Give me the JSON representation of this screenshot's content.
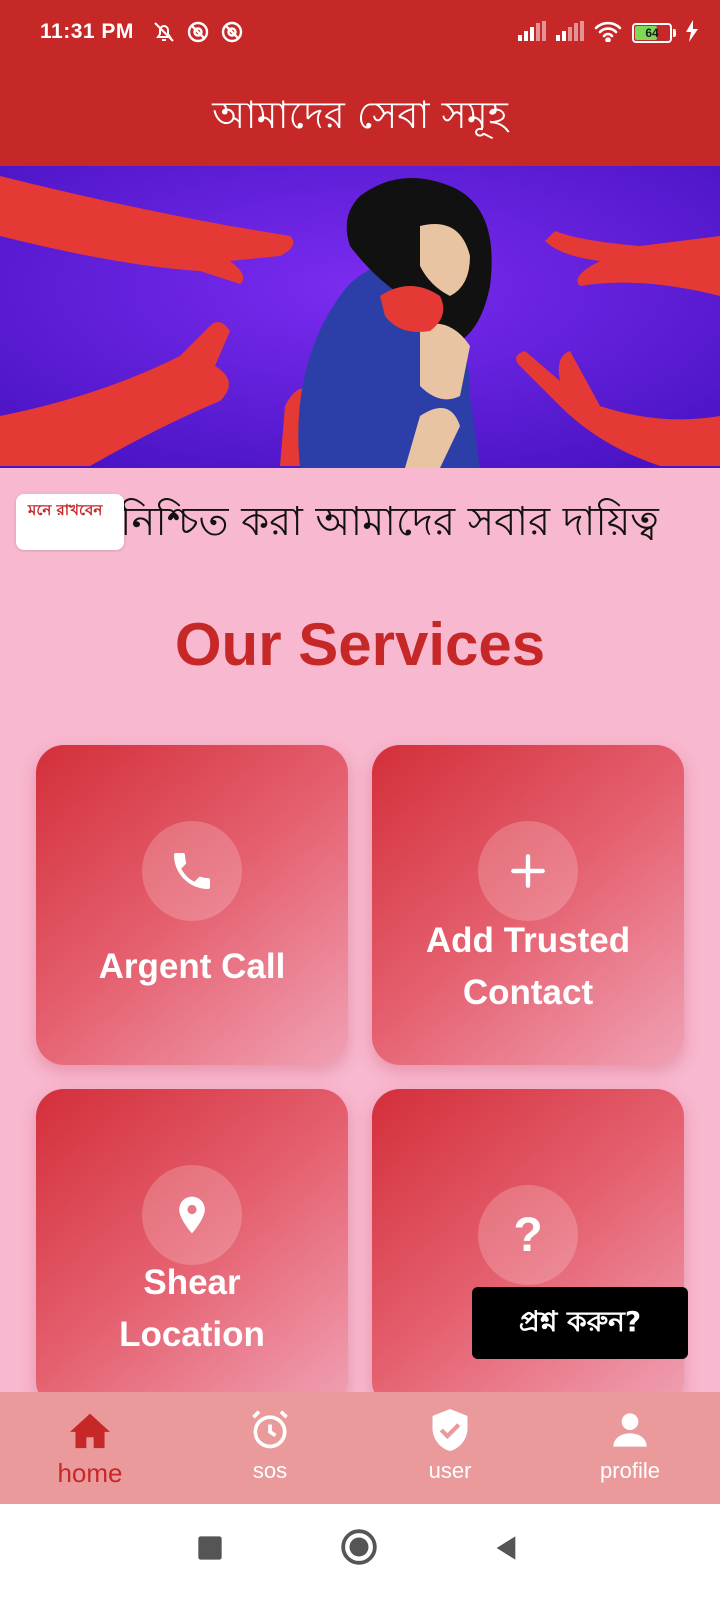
{
  "status_bar": {
    "time": "11:31 PM",
    "battery_level": "64",
    "icons_left": [
      "bell-off-icon",
      "dnd-icon",
      "dnd-icon"
    ],
    "icons_right": [
      "signal-icon",
      "signal-icon",
      "wifi-icon",
      "battery-icon",
      "charging-icon"
    ]
  },
  "appbar": {
    "title": "আমাদের সেবা সমূহ"
  },
  "banner": {
    "image": "illustration-woman-reaching-hands"
  },
  "notice": {
    "chip_label": "মনে রাখবেন",
    "marquee_text": "নিশ্চিত করা আমাদের সবার দায়িত্ব"
  },
  "services": {
    "title": "Our Services",
    "cards": [
      {
        "label": "Argent Call",
        "icon": "phone-icon"
      },
      {
        "label": "Add Trusted Contact",
        "icon": "plus-icon"
      },
      {
        "label": "Shear Location",
        "icon": "location-pin-icon"
      },
      {
        "label": "",
        "icon": "question-icon"
      }
    ]
  },
  "ask_button": {
    "label": "প্রশ্ন করুন?"
  },
  "bottom_nav": {
    "items": [
      {
        "label": "home",
        "icon": "home-icon",
        "active": true
      },
      {
        "label": "sos",
        "icon": "alarm-clock-icon",
        "active": false
      },
      {
        "label": "user",
        "icon": "shield-check-icon",
        "active": false
      },
      {
        "label": "profile",
        "icon": "person-icon",
        "active": false
      }
    ]
  },
  "colors": {
    "primary": "#c62828",
    "background": "#f8b8cf",
    "nav_background": "#eb9a9b",
    "card_gradient_start": "#d32f3a",
    "card_gradient_end": "#f0a1b4"
  }
}
